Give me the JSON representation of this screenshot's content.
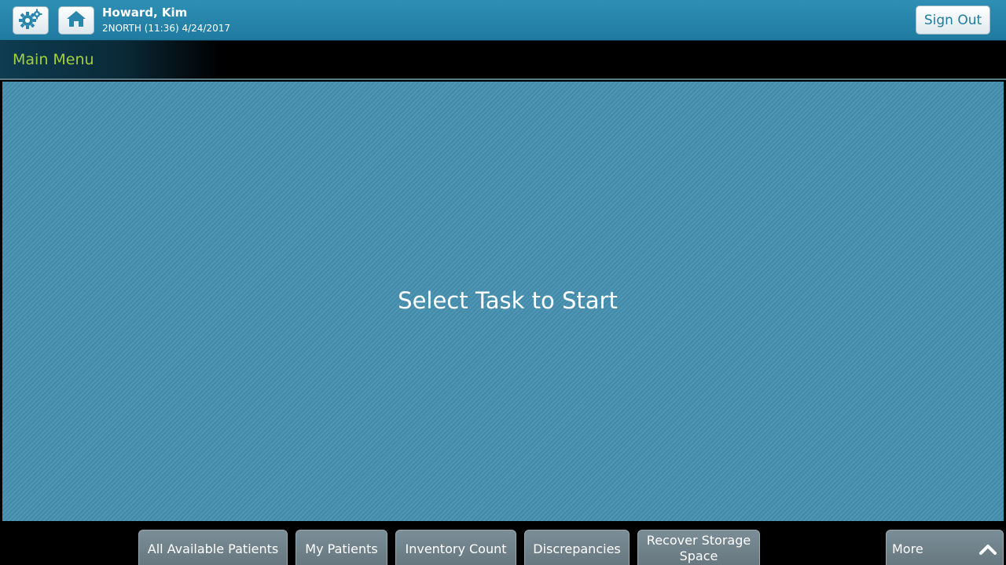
{
  "header": {
    "user_name": "Howard, Kim",
    "session_info": "2NORTH (11:36) 4/24/2017",
    "sign_out_label": "Sign Out"
  },
  "titlebar": {
    "title": "Main Menu"
  },
  "main": {
    "prompt": "Select Task to Start"
  },
  "footer": {
    "buttons": [
      {
        "label": "All Available Patients"
      },
      {
        "label": "My Patients"
      },
      {
        "label": "Inventory Count"
      },
      {
        "label": "Discrepancies"
      },
      {
        "label": "Recover Storage Space"
      }
    ],
    "more_label": "More"
  },
  "icons": [
    "gear-icon",
    "home-icon",
    "chevron-up-icon"
  ],
  "colors": {
    "header_blue": "#1f7aa0",
    "title_green": "#a3cf3f",
    "main_bg": "#4690b0",
    "tab_gray": "#707f87"
  }
}
